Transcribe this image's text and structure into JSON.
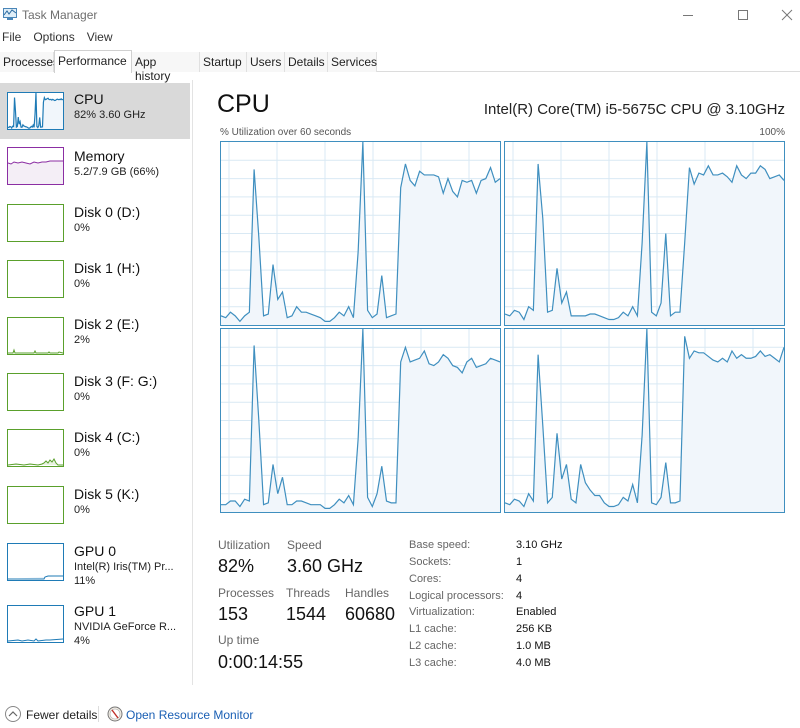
{
  "window": {
    "title": "Task Manager"
  },
  "menu": [
    "File",
    "Options",
    "View"
  ],
  "tabs": [
    {
      "label": "Processes"
    },
    {
      "label": "Performance",
      "active": true
    },
    {
      "label": "App history"
    },
    {
      "label": "Startup"
    },
    {
      "label": "Users"
    },
    {
      "label": "Details"
    },
    {
      "label": "Services"
    }
  ],
  "sidebar": {
    "items": [
      {
        "name": "CPU",
        "sub1": "82%  3.60 GHz",
        "sub2": "",
        "color": "#1f7bb6",
        "active": true
      },
      {
        "name": "Memory",
        "sub1": "5.2/7.9 GB (66%)",
        "sub2": "",
        "color": "#8b2ea3"
      },
      {
        "name": "Disk 0 (D:)",
        "sub1": "0%",
        "sub2": "",
        "color": "#5aa02c"
      },
      {
        "name": "Disk 1 (H:)",
        "sub1": "0%",
        "sub2": "",
        "color": "#5aa02c"
      },
      {
        "name": "Disk 2 (E:)",
        "sub1": "2%",
        "sub2": "",
        "color": "#5aa02c"
      },
      {
        "name": "Disk 3 (F: G:)",
        "sub1": "0%",
        "sub2": "",
        "color": "#5aa02c"
      },
      {
        "name": "Disk 4 (C:)",
        "sub1": "0%",
        "sub2": "",
        "color": "#5aa02c"
      },
      {
        "name": "Disk 5 (K:)",
        "sub1": "0%",
        "sub2": "",
        "color": "#5aa02c"
      },
      {
        "name": "GPU 0",
        "sub1": "Intel(R) Iris(TM) Pr...",
        "sub2": "11%",
        "color": "#1f7bb6"
      },
      {
        "name": "GPU 1",
        "sub1": "NVIDIA GeForce R...",
        "sub2": "4%",
        "color": "#1f7bb6"
      }
    ]
  },
  "main": {
    "title": "CPU",
    "cpu_model": "Intel(R) Core(TM) i5-5675C CPU @ 3.10GHz",
    "graph_label": "% Utilization over 60 seconds",
    "graph_max": "100%",
    "accent_color": "#3f8fbf"
  },
  "chart_data": {
    "type": "line",
    "title": "% Utilization over 60 seconds",
    "ylim": [
      0,
      100
    ],
    "xlim": [
      0,
      60
    ],
    "grid": true,
    "series": [
      {
        "name": "Core 0",
        "values": [
          5,
          4,
          7,
          5,
          2,
          5,
          7,
          85,
          48,
          5,
          6,
          33,
          14,
          18,
          4,
          5,
          10,
          7,
          7,
          6,
          5,
          4,
          2,
          2,
          4,
          7,
          5,
          10,
          4,
          40,
          100,
          8,
          4,
          6,
          27,
          4,
          5,
          6,
          75,
          88,
          79,
          76,
          84,
          82,
          82,
          82,
          81,
          72,
          80,
          73,
          70,
          79,
          78,
          79,
          72,
          79,
          80,
          86,
          78,
          80
        ]
      },
      {
        "name": "Core 1",
        "values": [
          6,
          5,
          8,
          7,
          3,
          10,
          8,
          88,
          58,
          7,
          8,
          31,
          12,
          18,
          5,
          5,
          5,
          5,
          6,
          6,
          5,
          4,
          3,
          3,
          4,
          7,
          5,
          10,
          5,
          45,
          100,
          7,
          5,
          12,
          50,
          5,
          7,
          7,
          45,
          86,
          77,
          83,
          82,
          87,
          82,
          82,
          83,
          81,
          78,
          87,
          82,
          80,
          83,
          83,
          87,
          85,
          80,
          81,
          82,
          79
        ]
      },
      {
        "name": "Core 2",
        "values": [
          4,
          4,
          6,
          6,
          3,
          7,
          6,
          91,
          50,
          4,
          5,
          26,
          10,
          19,
          4,
          4,
          6,
          6,
          5,
          4,
          4,
          4,
          2,
          2,
          4,
          7,
          5,
          9,
          4,
          40,
          100,
          8,
          3,
          10,
          25,
          6,
          5,
          5,
          82,
          90,
          82,
          83,
          84,
          88,
          81,
          80,
          82,
          86,
          84,
          80,
          79,
          76,
          82,
          84,
          79,
          80,
          81,
          84,
          83,
          82
        ]
      },
      {
        "name": "Core 3",
        "values": [
          5,
          4,
          7,
          6,
          3,
          10,
          6,
          86,
          47,
          5,
          8,
          43,
          18,
          26,
          7,
          5,
          26,
          16,
          12,
          9,
          9,
          5,
          3,
          3,
          4,
          8,
          6,
          15,
          5,
          42,
          100,
          5,
          4,
          8,
          27,
          5,
          5,
          6,
          96,
          84,
          88,
          87,
          87,
          85,
          83,
          82,
          84,
          82,
          88,
          84,
          86,
          84,
          84,
          85,
          88,
          85,
          86,
          84,
          82,
          90
        ]
      }
    ]
  },
  "stats": {
    "utilization": {
      "label": "Utilization",
      "value": "82%"
    },
    "speed": {
      "label": "Speed",
      "value": "3.60 GHz"
    },
    "processes": {
      "label": "Processes",
      "value": "153"
    },
    "threads": {
      "label": "Threads",
      "value": "1544"
    },
    "handles": {
      "label": "Handles",
      "value": "60680"
    },
    "uptime": {
      "label": "Up time",
      "value": "0:00:14:55"
    }
  },
  "specs": [
    {
      "label": "Base speed:",
      "value": "3.10 GHz"
    },
    {
      "label": "Sockets:",
      "value": "1"
    },
    {
      "label": "Cores:",
      "value": "4"
    },
    {
      "label": "Logical processors:",
      "value": "4"
    },
    {
      "label": "Virtualization:",
      "value": "Enabled"
    },
    {
      "label": "L1 cache:",
      "value": "256 KB"
    },
    {
      "label": "L2 cache:",
      "value": "1.0 MB"
    },
    {
      "label": "L3 cache:",
      "value": "4.0 MB"
    }
  ],
  "footer": {
    "fewer_details": "Fewer details",
    "open_resource_monitor": "Open Resource Monitor"
  }
}
